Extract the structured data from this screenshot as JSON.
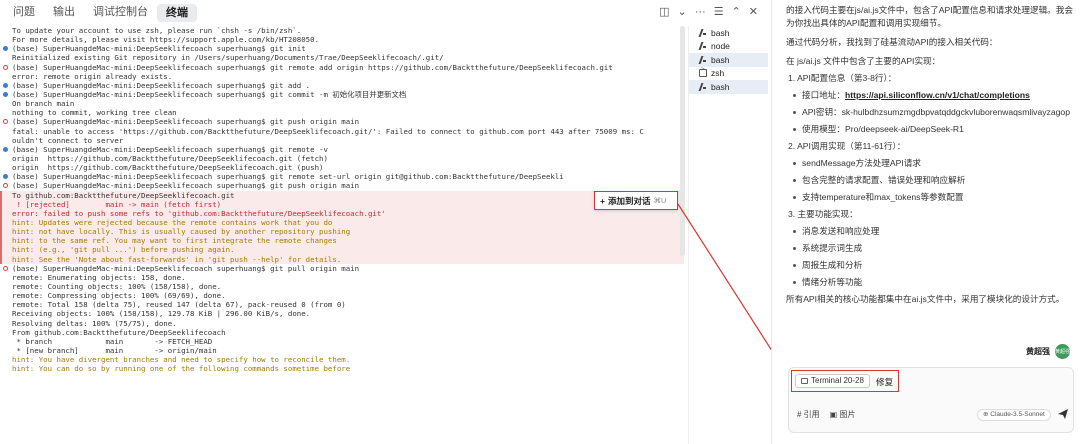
{
  "tabs": [
    {
      "label": "问题",
      "active": false
    },
    {
      "label": "输出",
      "active": false
    },
    {
      "label": "调试控制台",
      "active": false
    },
    {
      "label": "终端",
      "active": true
    }
  ],
  "tab_tools": {
    "layout": "◫",
    "chevron": "⌄",
    "more": "···",
    "list": "☰",
    "up": "⌃",
    "close": "✕"
  },
  "terminal": {
    "lines_before": [
      {
        "text": "To update your account to use zsh, please run `chsh -s /bin/zsh`.",
        "dot": "",
        "color": ""
      },
      {
        "text": "For more details, please visit https://support.apple.com/kb/HT208050.",
        "dot": "",
        "color": ""
      },
      {
        "text": "(base) SuperHuangdeMac-mini:DeepSeeklifecoach superhuang$ git init",
        "dot": "blue",
        "color": ""
      },
      {
        "text": "Reinitialized existing Git repository in /Users/superhuang/Documents/Trae/DeepSeeklifecoach/.git/",
        "dot": "",
        "color": ""
      },
      {
        "text": "(base) SuperHuangdeMac-mini:DeepSeeklifecoach superhuang$ git remote add origin https://github.com/Backtthefuture/DeepSeeklifecoach.git",
        "dot": "red",
        "color": ""
      },
      {
        "text": "error: remote origin already exists.",
        "dot": "",
        "color": ""
      },
      {
        "text": "(base) SuperHuangdeMac-mini:DeepSeeklifecoach superhuang$ git add .",
        "dot": "blue",
        "color": ""
      },
      {
        "text": "(base) SuperHuangdeMac-mini:DeepSeeklifecoach superhuang$ git commit -m 初始化项目并更新文档",
        "dot": "blue",
        "color": ""
      },
      {
        "text": "On branch main",
        "dot": "",
        "color": ""
      },
      {
        "text": "nothing to commit, working tree clean",
        "dot": "",
        "color": ""
      },
      {
        "text": "(base) SuperHuangdeMac-mini:DeepSeeklifecoach superhuang$ git push origin main",
        "dot": "red",
        "color": ""
      },
      {
        "text": "fatal: unable to access 'https://github.com/Backtthefuture/DeepSeeklifecoach.git/': Failed to connect to github.com port 443 after 75009 ms: C",
        "dot": "",
        "color": ""
      },
      {
        "text": "ouldn't connect to server",
        "dot": "",
        "color": ""
      },
      {
        "text": "(base) SuperHuangdeMac-mini:DeepSeeklifecoach superhuang$ git remote -v",
        "dot": "blue",
        "color": ""
      },
      {
        "text": "origin  https://github.com/Backtthefuture/DeepSeeklifecoach.git (fetch)",
        "dot": "",
        "color": ""
      },
      {
        "text": "origin  https://github.com/Backtthefuture/DeepSeeklifecoach.git (push)",
        "dot": "",
        "color": ""
      },
      {
        "text": "(base) SuperHuangdeMac-mini:DeepSeeklifecoach superhuang$ git remote set-url origin git@github.com:Backtthefuture/DeepSeekli",
        "dot": "blue",
        "color": ""
      },
      {
        "text": "(base) SuperHuangdeMac-mini:DeepSeeklifecoach superhuang$ git push origin main",
        "dot": "red",
        "color": ""
      }
    ],
    "lines_error": [
      {
        "text": "To github.com:Backtthefuture/DeepSeeklifecoach.git",
        "color": ""
      },
      {
        "text": " ! [rejected]        main -> main (fetch first)",
        "color": "red"
      },
      {
        "text": "error: failed to push some refs to 'github.com:Backtthefuture/DeepSeeklifecoach.git'",
        "color": "red"
      },
      {
        "text": "hint: Updates were rejected because the remote contains work that you do",
        "color": "yellow"
      },
      {
        "text": "hint: not have locally. This is usually caused by another repository pushing",
        "color": "yellow"
      },
      {
        "text": "hint: to the same ref. You may want to first integrate the remote changes",
        "color": "yellow"
      },
      {
        "text": "hint: (e.g., 'git pull ...') before pushing again.",
        "color": "yellow"
      },
      {
        "text": "hint: See the 'Note about fast-forwards' in 'git push --help' for details.",
        "color": "yellow"
      }
    ],
    "lines_after": [
      {
        "text": "(base) SuperHuangdeMac-mini:DeepSeeklifecoach superhuang$ git pull origin main",
        "dot": "red",
        "color": ""
      },
      {
        "text": "remote: Enumerating objects: 158, done.",
        "dot": "",
        "color": ""
      },
      {
        "text": "remote: Counting objects: 100% (158/158), done.",
        "dot": "",
        "color": ""
      },
      {
        "text": "remote: Compressing objects: 100% (69/69), done.",
        "dot": "",
        "color": ""
      },
      {
        "text": "remote: Total 158 (delta 75), reused 147 (delta 67), pack-reused 0 (from 0)",
        "dot": "",
        "color": ""
      },
      {
        "text": "Receiving objects: 100% (158/158), 129.78 KiB | 296.00 KiB/s, done.",
        "dot": "",
        "color": ""
      },
      {
        "text": "Resolving deltas: 100% (75/75), done.",
        "dot": "",
        "color": ""
      },
      {
        "text": "From github.com:Backtthefuture/DeepSeeklifecoach",
        "dot": "",
        "color": ""
      },
      {
        "text": " * branch            main       -> FETCH_HEAD",
        "dot": "",
        "color": ""
      },
      {
        "text": " * [new branch]      main       -> origin/main",
        "dot": "",
        "color": ""
      },
      {
        "text": "hint: You have divergent branches and need to specify how to reconcile them.",
        "dot": "",
        "color": "yellow"
      },
      {
        "text": "hint: You can do so by running one of the following commands sometime before",
        "dot": "",
        "color": "yellow"
      }
    ]
  },
  "add_to_chat": {
    "plus": "+",
    "label": "添加到对话",
    "shortcut": "⌘U"
  },
  "sessions": [
    {
      "label": "bash",
      "icon": "bash",
      "selected": false
    },
    {
      "label": "node",
      "icon": "bash",
      "selected": false
    },
    {
      "label": "bash",
      "icon": "bash",
      "selected": true
    },
    {
      "label": "zsh",
      "icon": "zsh",
      "selected": false
    },
    {
      "label": "bash",
      "icon": "bash",
      "selected": true
    }
  ],
  "chat": {
    "intro": "的接入代码主要在js/ai.js文件中，包含了API配置信息和请求处理逻辑。我会为你找出具体的API配置和调用实现细节。",
    "found": "通过代码分析，我找到了硅基流动API的接入相关代码：",
    "file_note": "在 js/ai.js 文件中包含了主要的API实现：",
    "sections": [
      {
        "title": "1. API配置信息（第3-8行）：",
        "items": [
          {
            "text": "接口地址：",
            "link": "https://api.siliconflow.cn/v1/chat/completions"
          },
          {
            "text": "API密钥：sk-hulbdhzsumzmgdbpvatqddgckvluborenwaqsmlivayzagop",
            "link": ""
          },
          {
            "text": "使用模型：Pro/deepseek-ai/DeepSeek-R1",
            "link": ""
          }
        ]
      },
      {
        "title": "2. API调用实现（第11-61行）：",
        "items": [
          {
            "text": "sendMessage方法处理API请求",
            "link": ""
          },
          {
            "text": "包含完整的请求配置、错误处理和响应解析",
            "link": ""
          },
          {
            "text": "支持temperature和max_tokens等参数配置",
            "link": ""
          }
        ]
      },
      {
        "title": "3. 主要功能实现：",
        "items": [
          {
            "text": "消息发送和响应处理",
            "link": ""
          },
          {
            "text": "系统提示词生成",
            "link": ""
          },
          {
            "text": "周报生成和分析",
            "link": ""
          },
          {
            "text": "情绪分析等功能",
            "link": ""
          }
        ]
      }
    ],
    "conclusion": "所有API相关的核心功能都集中在ai.js文件中，采用了模块化的设计方式。"
  },
  "user": {
    "name": "黄超强",
    "avatar_text": "黄超强"
  },
  "input": {
    "chip_label": "Terminal 20-28",
    "message": "修复",
    "ref_label": "# 引用",
    "image_label": "图片",
    "model_label": "Claude-3.5-Sonnet"
  },
  "colors": {
    "accent_red": "#e0342a",
    "error_bg": "#fbeaea",
    "prompt_blue": "#3a7bd5"
  }
}
